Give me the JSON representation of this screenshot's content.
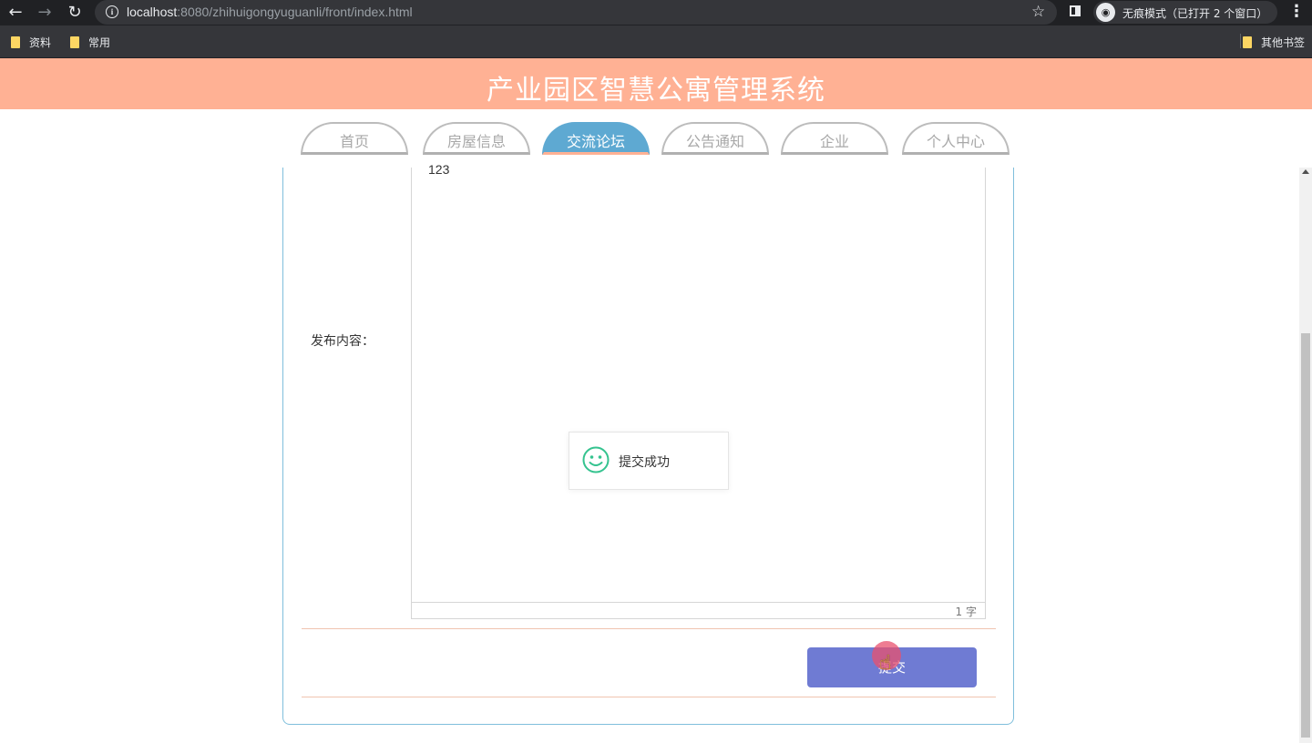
{
  "browser": {
    "url_host": "localhost",
    "url_rest": ":8080/zhihuigongyuguanli/front/index.html",
    "incognito_text": "无痕模式（已打开 2 个窗口）",
    "bookmarks": [
      {
        "label": "资料"
      },
      {
        "label": "常用"
      }
    ],
    "other_bookmarks": "其他书签"
  },
  "site": {
    "title": "产业园区智慧公寓管理系统"
  },
  "nav": {
    "tabs": [
      {
        "label": "首页",
        "active": false
      },
      {
        "label": "房屋信息",
        "active": false
      },
      {
        "label": "交流论坛",
        "active": true
      },
      {
        "label": "公告通知",
        "active": false
      },
      {
        "label": "企业",
        "active": false
      },
      {
        "label": "个人中心",
        "active": false
      }
    ]
  },
  "form": {
    "content_label": "发布内容：",
    "content_value": "123",
    "word_count": "1 字",
    "submit_label": "提交"
  },
  "toast": {
    "message": "提交成功",
    "color": "#35c38f"
  },
  "colors": {
    "header": "#ffb194",
    "active_tab": "#5ea9d2",
    "submit_button": "#6f7bd3"
  }
}
